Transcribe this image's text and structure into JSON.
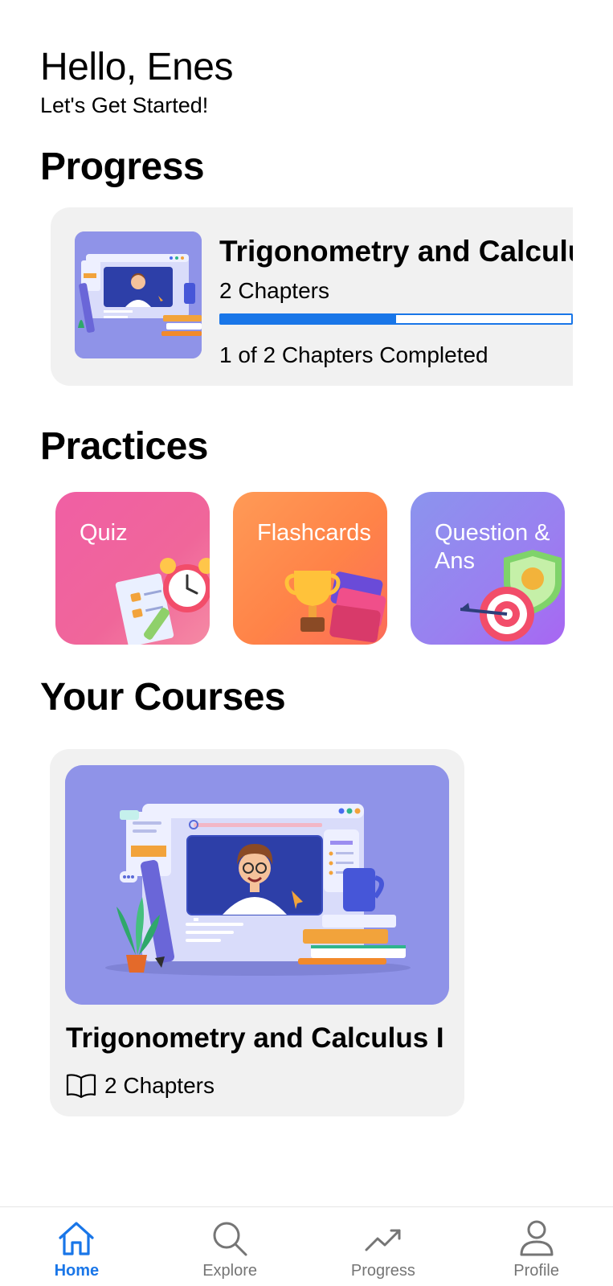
{
  "greeting": {
    "title": "Hello, Enes",
    "subtitle": "Let's Get Started!"
  },
  "progress": {
    "section_title": "Progress",
    "card": {
      "course_title": "Trigonometry and Calculus I",
      "chapters": "2 Chapters",
      "completion_fraction": 0.5,
      "status": "1 of 2 Chapters Completed",
      "thumbnail_icon": "online-lecture-illustration"
    }
  },
  "practices": {
    "section_title": "Practices",
    "items": [
      {
        "label": "Quiz",
        "icon": "alarm-clock-checklist-illustration",
        "colors": [
          "#f05fa4",
          "#f58aa4"
        ]
      },
      {
        "label": "Flashcards",
        "icon": "trophy-illustration",
        "colors": [
          "#ff9a56",
          "#fb6c5a"
        ]
      },
      {
        "label": "Question & Ans",
        "icon": "target-shield-illustration",
        "colors": [
          "#8b94ee",
          "#a866f3"
        ]
      }
    ]
  },
  "courses": {
    "section_title": "Your Courses",
    "items": [
      {
        "title": "Trigonometry and Calculus I",
        "chapters": "2 Chapters",
        "image_icon": "online-lecture-illustration"
      }
    ]
  },
  "nav": {
    "items": [
      {
        "label": "Home",
        "icon": "home-icon",
        "active": true
      },
      {
        "label": "Explore",
        "icon": "search-icon",
        "active": false
      },
      {
        "label": "Progress",
        "icon": "trending-up-icon",
        "active": false
      },
      {
        "label": "Profile",
        "icon": "person-icon",
        "active": false
      }
    ]
  },
  "colors": {
    "accent": "#1976e8",
    "card_background": "#f1f1f1",
    "inactive_nav": "#757575"
  }
}
